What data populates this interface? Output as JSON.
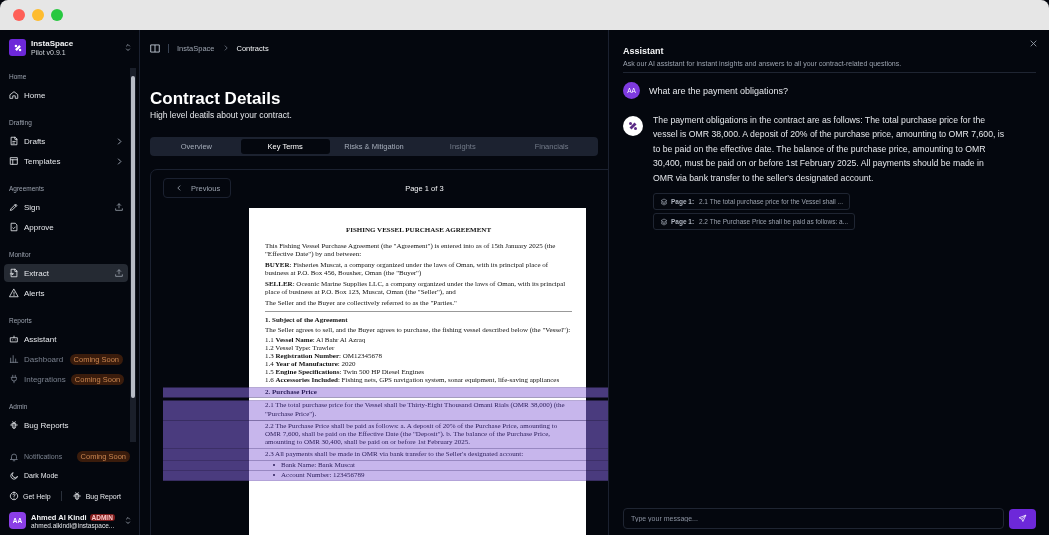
{
  "sidebar": {
    "brand": {
      "name": "InstaSpace",
      "version": "Pilot v0.9.1"
    },
    "sections": [
      {
        "title": "Home",
        "items": [
          {
            "label": "Home",
            "selected": false,
            "disabled": false
          }
        ]
      },
      {
        "title": "Drafting",
        "items": [
          {
            "label": "Drafts",
            "selected": false,
            "disabled": false
          },
          {
            "label": "Templates",
            "selected": false,
            "disabled": false
          }
        ]
      },
      {
        "title": "Agreements",
        "items": [
          {
            "label": "Sign",
            "selected": false,
            "disabled": false
          },
          {
            "label": "Approve",
            "selected": false,
            "disabled": false
          }
        ]
      },
      {
        "title": "Monitor",
        "items": [
          {
            "label": "Extract",
            "selected": true,
            "disabled": false
          },
          {
            "label": "Alerts",
            "selected": false,
            "disabled": false
          }
        ]
      },
      {
        "title": "Reports",
        "items": [
          {
            "label": "Assistant",
            "selected": false,
            "disabled": false
          },
          {
            "label": "Dashboard",
            "selected": false,
            "disabled": true,
            "badge": "Coming Soon"
          },
          {
            "label": "Integrations",
            "selected": false,
            "disabled": true,
            "badge": "Coming Soon"
          }
        ]
      },
      {
        "title": "Admin",
        "items": [
          {
            "label": "Bug Reports",
            "selected": false,
            "disabled": false
          }
        ]
      }
    ],
    "footer_items": [
      {
        "label": "Notifications",
        "selected": false,
        "disabled": true,
        "badge": "Coming Soon"
      },
      {
        "label": "Dark Mode",
        "selected": false,
        "disabled": false
      }
    ],
    "links": [
      {
        "label": "Get Help"
      },
      {
        "label": "Bug Report"
      }
    ],
    "user": {
      "initials": "AA",
      "name": "Ahmed Al Kindi",
      "role": "ADMIN",
      "email": "ahmed.alkindi@instaspace..."
    }
  },
  "breadcrumb": [
    "InstaSpace",
    "Contracts"
  ],
  "header": {
    "title": "Contract Details",
    "subtitle": "High level deatils about your contract."
  },
  "tabs": [
    {
      "label": "Overview",
      "selected": false,
      "disabled": false
    },
    {
      "label": "Key Terms",
      "selected": true,
      "disabled": false
    },
    {
      "label": "Risks & Mitigation",
      "selected": false,
      "disabled": false
    },
    {
      "label": "Insights",
      "selected": false,
      "disabled": true
    },
    {
      "label": "Financials",
      "selected": false,
      "disabled": true
    }
  ],
  "viewer": {
    "previous": "Previous",
    "page_label": "Page 1 of 3",
    "document": [
      {
        "kind": "title",
        "text": "FISHING VESSEL PURCHASE AGREEMENT",
        "highlighted": false
      },
      {
        "kind": "para",
        "text": "This Fishing Vessel Purchase Agreement (the \"Agreement\") is entered into as of 15th January 2025 (the \"Effective Date\") by and between:",
        "highlighted": false
      },
      {
        "kind": "para",
        "text": "**BUYER**: Fisheries Muscat, a company organized under the laws of Oman, with its principal place of business at P.O. Box 456, Bousher, Oman (the \"Buyer\")",
        "highlighted": false
      },
      {
        "kind": "para",
        "text": "**SELLER**: Oceanic Marine Supplies LLC, a company organized under the laws of Oman, with its principal place of business at P.O. Box 123, Muscat, Oman (the \"Seller\"), and",
        "highlighted": false
      },
      {
        "kind": "para",
        "text": "The Seller and the Buyer are collectively referred to as the \"Parties.\"",
        "highlighted": false
      },
      {
        "kind": "rule",
        "highlighted": false
      },
      {
        "kind": "heading",
        "text": "1. Subject of the Agreement",
        "highlighted": false
      },
      {
        "kind": "para",
        "text": "The Seller agrees to sell, and the Buyer agrees to purchase, the fishing vessel described below (the \"Vessel\"):",
        "highlighted": false
      },
      {
        "kind": "line",
        "text": "1.1 **Vessel Name**: Al Bahr Al Azraq",
        "highlighted": false
      },
      {
        "kind": "line",
        "text": "1.2 Vessel Type: Trawler",
        "highlighted": false
      },
      {
        "kind": "line",
        "text": "1.3 **Registration Number**: OM12345678",
        "highlighted": false
      },
      {
        "kind": "line",
        "text": "1.4 **Year of Manufacture**: 2020",
        "highlighted": false
      },
      {
        "kind": "line",
        "text": "1.5 **Engine Specifications**: Twin 500 HP Diesel Engines",
        "highlighted": false
      },
      {
        "kind": "line",
        "text": "1.6 **Accessories Included**: Fishing nets, GPS navigation system, sonar equipment, life-saving appliances",
        "highlighted": false
      },
      {
        "kind": "heading",
        "text": "2. Purchase Price",
        "highlighted": true
      },
      {
        "kind": "para",
        "text": "2.1 The total purchase price for the Vessel shall be Thirty-Eight Thousand Omani Rials (OMR 38,000) (the \"Purchase Price\").",
        "highlighted": true
      },
      {
        "kind": "para",
        "text": "2.2 The Purchase Price shall be paid as follows: a. A deposit of 20% of the Purchase Price, amounting to OMR 7,600, shall be paid on the Effective Date (the \"Deposit\"). b. The balance of the Purchase Price, amounting to OMR 30,400, shall be paid on or before 1st February 2025.",
        "highlighted": true
      },
      {
        "kind": "para",
        "text": "2.3 All payments shall be made in OMR via bank transfer to the Seller's designated account:",
        "highlighted": true
      },
      {
        "kind": "bullet",
        "text": "Bank Name: Bank Muscat",
        "highlighted": true
      },
      {
        "kind": "bullet",
        "text": "Account Number: 123456789",
        "highlighted": true
      }
    ]
  },
  "assistant": {
    "title": "Assistant",
    "subtitle": "Ask our AI assistant for instant insights and answers to all your contract-related questions.",
    "messages": [
      {
        "kind": "question",
        "initials": "AA",
        "text": "What are the payment obligations?"
      },
      {
        "kind": "answer",
        "text": "The payment obligations in the contract are as follows: The total purchase price for the vessel is OMR 38,000. A deposit of 20% of the purchase price, amounting to OMR 7,600, is to be paid on the effective date. The balance of the purchase price, amounting to OMR 30,400, must be paid on or before 1st February 2025. All payments should be made in OMR via bank transfer to the seller's designated account.",
        "sources": [
          {
            "page": "Page 1:",
            "text": "2.1 The total purchase price for the Vessel shall ..."
          },
          {
            "page": "Page 1:",
            "text": "2.2 The Purchase Price shall be paid as follows: a..."
          }
        ]
      }
    ],
    "input": {
      "placeholder": "Type your message..."
    }
  }
}
